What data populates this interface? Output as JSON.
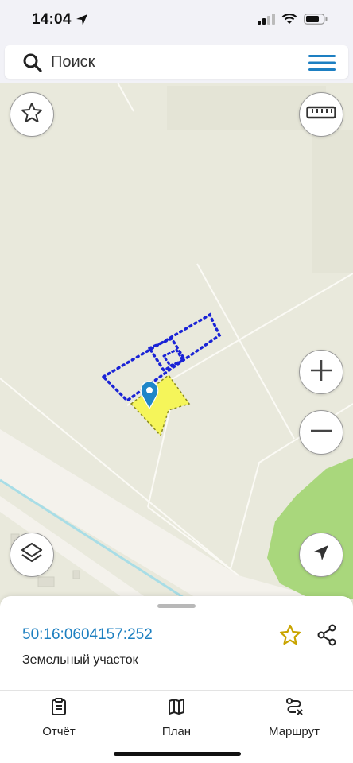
{
  "status_bar": {
    "time": "14:04",
    "icons": [
      "location-arrow-icon",
      "signal-icon",
      "wifi-icon",
      "battery-icon"
    ]
  },
  "search": {
    "placeholder": "Поиск",
    "icon": "search-icon",
    "menu_icon": "hamburger-menu-icon"
  },
  "map": {
    "colors": {
      "land": "#e9e9dc",
      "road": "#f4f2ec",
      "forest": "#a9d77c",
      "water": "#a8dde6",
      "selected_parcel_fill": "#f5f55a",
      "parcel_outline": "#1a23d6",
      "marker": "#1f86c8"
    },
    "buttons": {
      "favorite": "star-outline-icon",
      "ruler": "ruler-icon",
      "zoom_in": "plus-icon",
      "zoom_out": "minus-icon",
      "layers": "layers-icon",
      "locate": "navigation-arrow-icon"
    }
  },
  "sheet": {
    "cadastral_number": "50:16:0604157:252",
    "object_type": "Земельный участок",
    "favorite_color": "#c9a400"
  },
  "tabs": [
    {
      "label": "Отчёт",
      "icon": "report-clipboard-icon"
    },
    {
      "label": "План",
      "icon": "map-plan-icon"
    },
    {
      "label": "Маршрут",
      "icon": "route-icon"
    }
  ]
}
